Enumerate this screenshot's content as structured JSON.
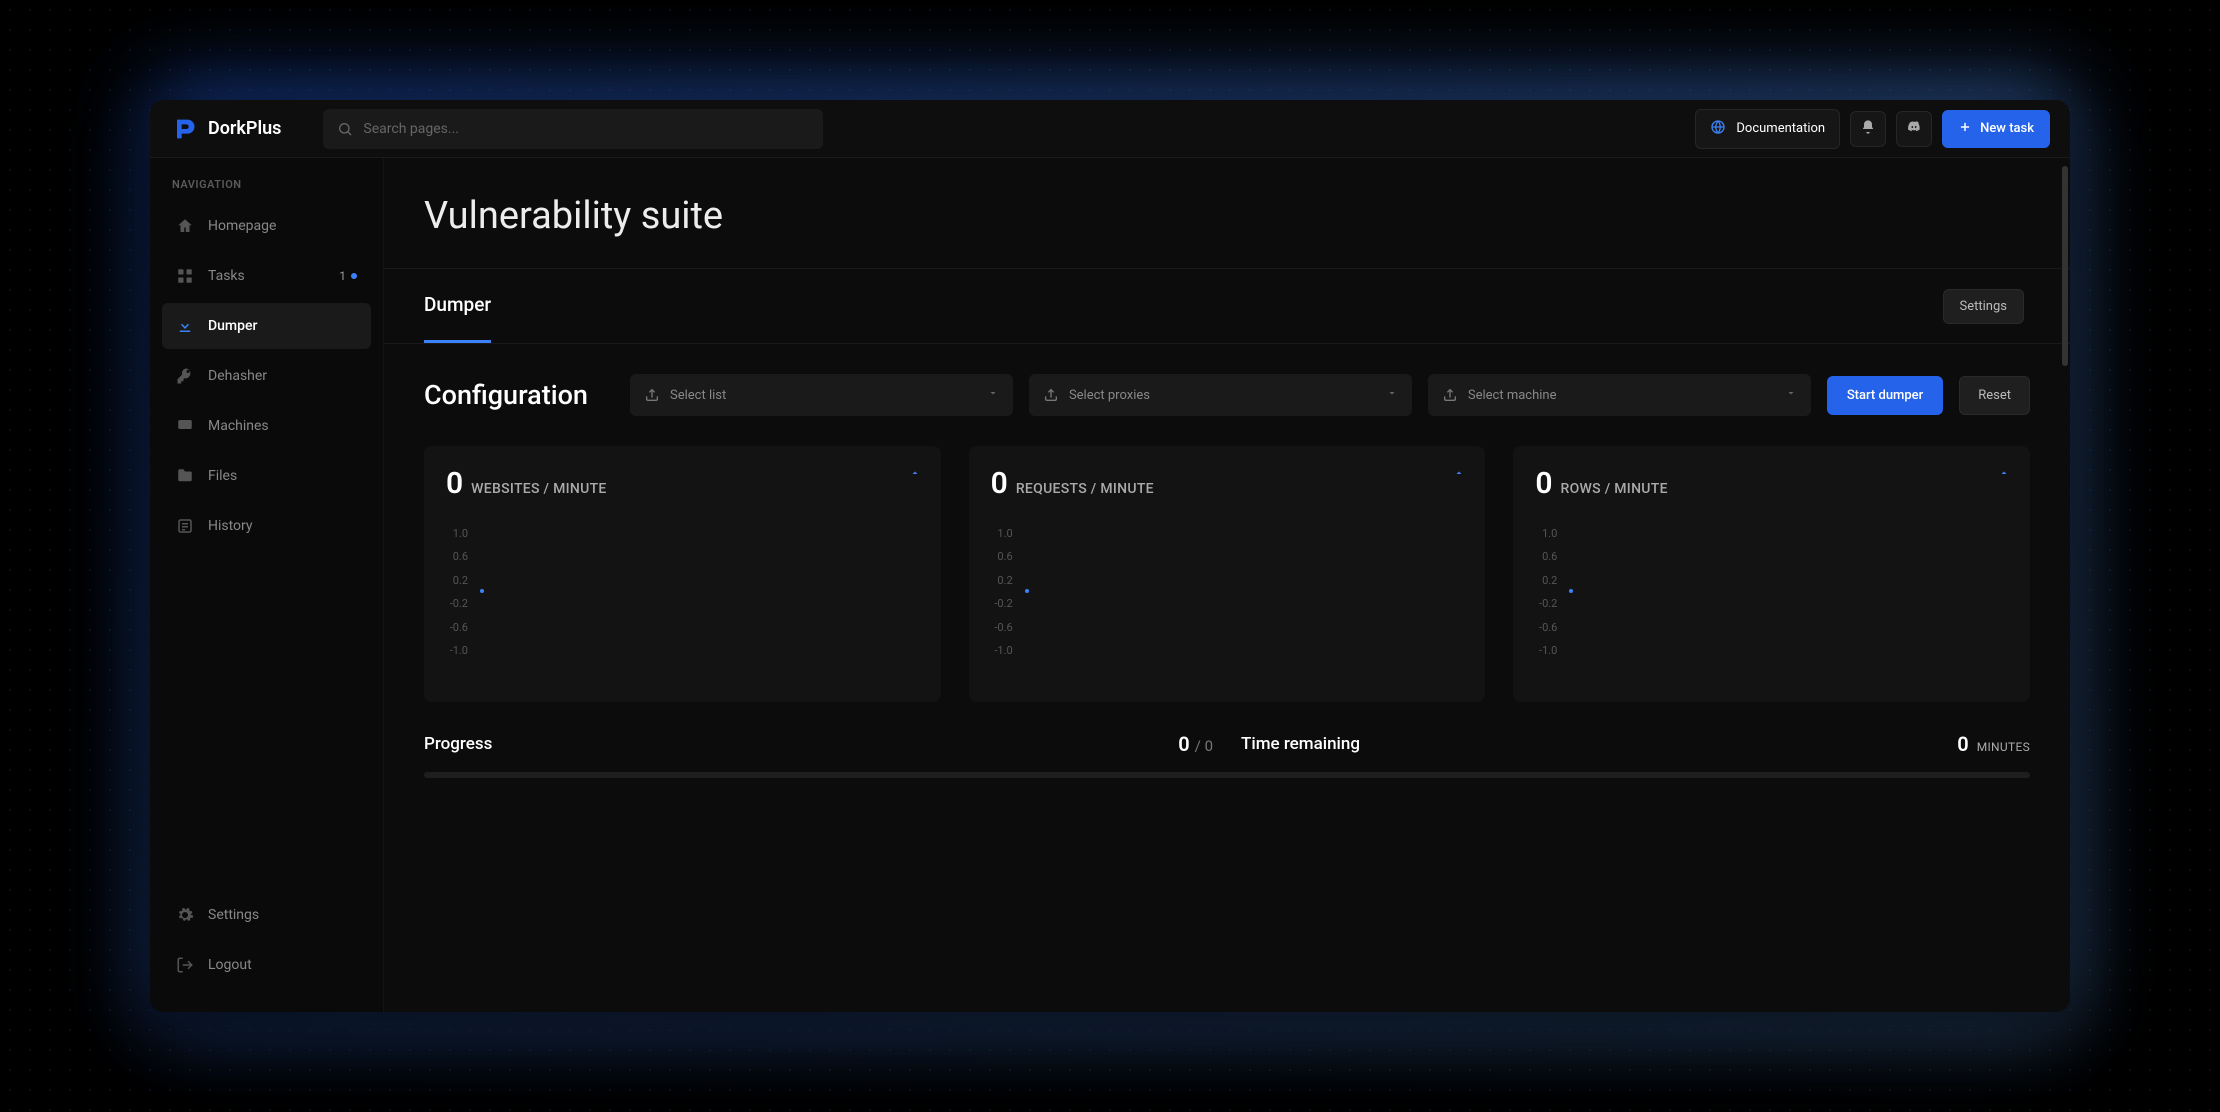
{
  "brand": "DorkPlus",
  "search": {
    "placeholder": "Search pages..."
  },
  "header": {
    "documentation": "Documentation",
    "new_task": "New task"
  },
  "sidebar": {
    "heading": "NAVIGATION",
    "items": [
      {
        "label": "Homepage"
      },
      {
        "label": "Tasks",
        "badge": "1"
      },
      {
        "label": "Dumper"
      },
      {
        "label": "Dehasher"
      },
      {
        "label": "Machines"
      },
      {
        "label": "Files"
      },
      {
        "label": "History"
      }
    ],
    "footer": [
      {
        "label": "Settings"
      },
      {
        "label": "Logout"
      }
    ]
  },
  "page": {
    "title": "Vulnerability suite",
    "active_tab": "Dumper",
    "settings_btn": "Settings"
  },
  "config": {
    "title": "Configuration",
    "select_list": "Select list",
    "select_proxies": "Select proxies",
    "select_machine": "Select machine",
    "start": "Start dumper",
    "reset": "Reset"
  },
  "stats": [
    {
      "value": "0",
      "label": "WEBSITES / MINUTE"
    },
    {
      "value": "0",
      "label": "REQUESTS / MINUTE"
    },
    {
      "value": "0",
      "label": "ROWS / MINUTE"
    }
  ],
  "chart_data": [
    {
      "type": "line",
      "title": "WEBSITES / MINUTE",
      "x": [
        0
      ],
      "values": [
        0
      ],
      "ylim": [
        -1.0,
        1.0
      ],
      "yticks": [
        "1.0",
        "0.6",
        "0.2",
        "-0.2",
        "-0.6",
        "-1.0"
      ]
    },
    {
      "type": "line",
      "title": "REQUESTS / MINUTE",
      "x": [
        0
      ],
      "values": [
        0
      ],
      "ylim": [
        -1.0,
        1.0
      ],
      "yticks": [
        "1.0",
        "0.6",
        "0.2",
        "-0.2",
        "-0.6",
        "-1.0"
      ]
    },
    {
      "type": "line",
      "title": "ROWS / MINUTE",
      "x": [
        0
      ],
      "values": [
        0
      ],
      "ylim": [
        -1.0,
        1.0
      ],
      "yticks": [
        "1.0",
        "0.6",
        "0.2",
        "-0.2",
        "-0.6",
        "-1.0"
      ]
    }
  ],
  "progress": {
    "label": "Progress",
    "current": "0",
    "total": "/ 0",
    "time_label": "Time remaining",
    "time_value": "0",
    "time_unit": "MINUTES"
  }
}
